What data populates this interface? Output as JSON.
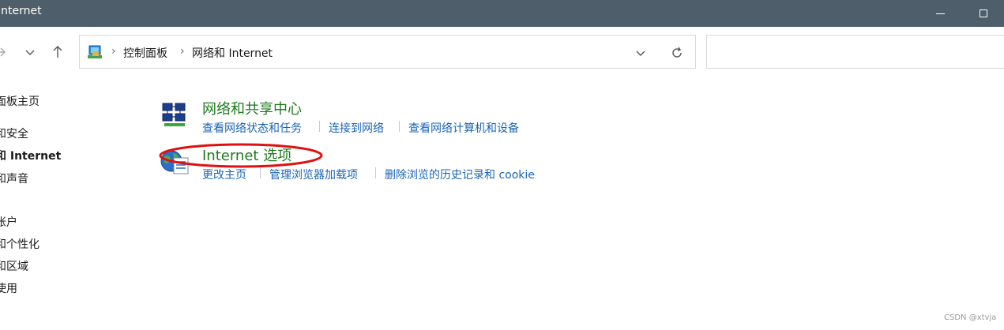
{
  "window": {
    "title": "Internet",
    "controls": {
      "minimize_icon": "minimize-icon",
      "maximize_icon": "maximize-icon"
    }
  },
  "nav": {
    "forward_icon": "arrow-right-icon",
    "recent_icon": "chevron-down-icon",
    "up_icon": "arrow-up-icon"
  },
  "address": {
    "icon": "control-panel-icon",
    "separator": "›",
    "breadcrumbs": [
      "控制面板",
      "网络和 Internet"
    ],
    "dropdown_icon": "chevron-down-icon",
    "refresh_icon": "refresh-icon"
  },
  "search": {
    "value": ""
  },
  "sidebar": {
    "items": [
      {
        "label": "面板主页"
      },
      {
        "label": "和安全"
      },
      {
        "label": "和 Internet",
        "active": true
      },
      {
        "label": "和声音"
      },
      {
        "label": "帐户"
      },
      {
        "label": "和个性化"
      },
      {
        "label": "和区域"
      },
      {
        "label": "使用"
      }
    ]
  },
  "categories": [
    {
      "icon": "network-sharing-icon",
      "title": "网络和共享中心",
      "links": [
        "查看网络状态和任务",
        "连接到网络",
        "查看网络计算机和设备"
      ]
    },
    {
      "icon": "internet-options-icon",
      "title": "Internet 选项",
      "links": [
        "更改主页",
        "管理浏览器加载项",
        "删除浏览的历史记录和 cookie"
      ]
    }
  ],
  "annotation": {
    "color": "#e01010"
  },
  "colors": {
    "titlebar": "#4e5f6b",
    "category_title": "#1d7a1d",
    "link": "#1a64b8"
  },
  "watermark": "CSDN @xtvja"
}
